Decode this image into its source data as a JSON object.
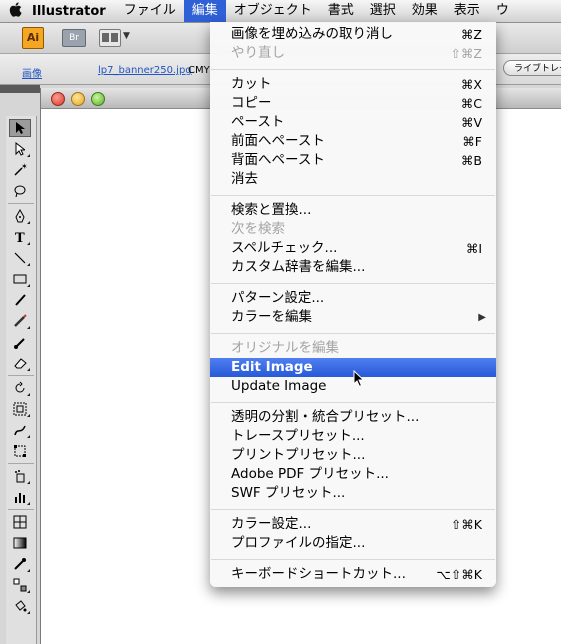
{
  "menubar": {
    "app_name": "Illustrator",
    "menus": [
      "ファイル",
      "編集",
      "オブジェクト",
      "書式",
      "選択",
      "効果",
      "表示",
      "ウ"
    ],
    "active_index": 1
  },
  "controlbar": {
    "ai_label": "Ai",
    "br_label": "Br"
  },
  "propbar": {
    "kind": "画像",
    "file": "lp7_banner250.jpg",
    "color": "CMYK",
    "trace_button": "ライブトレース"
  },
  "edit_menu": {
    "items": [
      {
        "label": "画像を埋め込みの取り消し",
        "shortcut": "⌘Z",
        "state": "normal"
      },
      {
        "label": "やり直し",
        "shortcut": "⇧⌘Z",
        "state": "disabled"
      },
      {
        "label": "カット",
        "shortcut": "⌘X",
        "state": "normal"
      },
      {
        "label": "コピー",
        "shortcut": "⌘C",
        "state": "normal"
      },
      {
        "label": "ペースト",
        "shortcut": "⌘V",
        "state": "normal"
      },
      {
        "label": "前面へペースト",
        "shortcut": "⌘F",
        "state": "normal"
      },
      {
        "label": "背面へペースト",
        "shortcut": "⌘B",
        "state": "normal"
      },
      {
        "label": "消去",
        "shortcut": "",
        "state": "normal"
      },
      {
        "label": "検索と置換...",
        "shortcut": "",
        "state": "normal"
      },
      {
        "label": "次を検索",
        "shortcut": "",
        "state": "disabled"
      },
      {
        "label": "スペルチェック...",
        "shortcut": "⌘I",
        "state": "normal"
      },
      {
        "label": "カスタム辞書を編集...",
        "shortcut": "",
        "state": "normal"
      },
      {
        "label": "パターン設定...",
        "shortcut": "",
        "state": "normal"
      },
      {
        "label": "カラーを編集",
        "shortcut": "",
        "state": "normal",
        "submenu": true
      },
      {
        "label": "オリジナルを編集",
        "shortcut": "",
        "state": "disabled"
      },
      {
        "label": "Edit Image",
        "shortcut": "",
        "state": "highlighted"
      },
      {
        "label": "Update Image",
        "shortcut": "",
        "state": "normal"
      },
      {
        "label": "透明の分割・統合プリセット...",
        "shortcut": "",
        "state": "normal"
      },
      {
        "label": "トレースプリセット...",
        "shortcut": "",
        "state": "normal"
      },
      {
        "label": "プリントプリセット...",
        "shortcut": "",
        "state": "normal"
      },
      {
        "label": "Adobe PDF プリセット...",
        "shortcut": "",
        "state": "normal"
      },
      {
        "label": "SWF プリセット...",
        "shortcut": "",
        "state": "normal"
      },
      {
        "label": "カラー設定...",
        "shortcut": "⇧⌘K",
        "state": "normal"
      },
      {
        "label": "プロファイルの指定...",
        "shortcut": "",
        "state": "normal"
      },
      {
        "label": "キーボードショートカット...",
        "shortcut": "⌥⇧⌘K",
        "state": "normal"
      }
    ]
  },
  "tools": [
    "selection-tool-icon",
    "direct-selection-tool-icon",
    "magic-wand-tool-icon",
    "lasso-tool-icon",
    "pen-tool-icon",
    "type-tool-icon",
    "line-tool-icon",
    "rectangle-tool-icon",
    "paintbrush-tool-icon",
    "pencil-tool-icon",
    "blob-brush-tool-icon",
    "eraser-tool-icon",
    "rotate-tool-icon",
    "scale-tool-icon",
    "warp-tool-icon",
    "free-transform-tool-icon",
    "symbol-sprayer-tool-icon",
    "column-graph-tool-icon",
    "mesh-tool-icon",
    "gradient-tool-icon",
    "eyedropper-tool-icon",
    "blend-tool-icon",
    "live-paint-bucket-tool-icon",
    "live-paint-selection-tool-icon"
  ]
}
